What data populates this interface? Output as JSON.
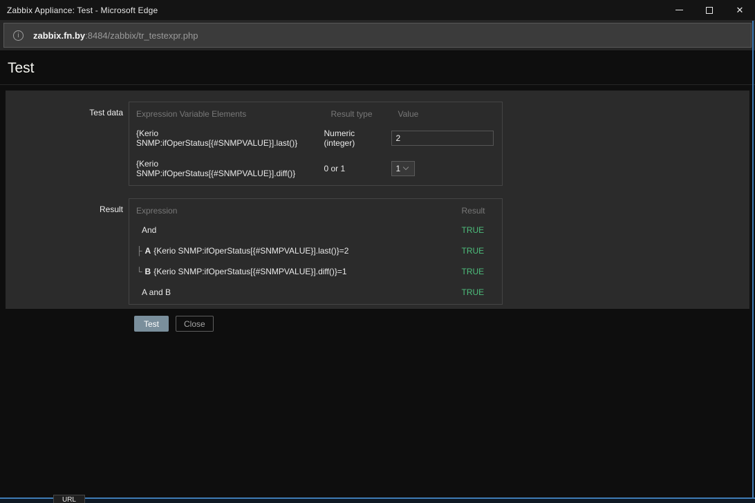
{
  "window": {
    "title": "Zabbix Appliance: Test - Microsoft Edge",
    "close_glyph": "✕"
  },
  "address_bar": {
    "info_glyph": "i",
    "host": "zabbix.fn.by",
    "path": ":8484/zabbix/tr_testexpr.php"
  },
  "page": {
    "heading": "Test",
    "test_data": {
      "label": "Test data",
      "headers": [
        "Expression Variable Elements",
        "Result type",
        "Value"
      ],
      "rows": [
        {
          "expression": "{Kerio SNMP:ifOperStatus[{#SNMPVALUE}].last()}",
          "result_type": "Numeric (integer)",
          "value": "2",
          "control": "text-input"
        },
        {
          "expression": "{Kerio SNMP:ifOperStatus[{#SNMPVALUE}].diff()}",
          "result_type": "0 or 1",
          "value": "1",
          "control": "select"
        }
      ]
    },
    "result": {
      "label": "Result",
      "headers": [
        "Expression",
        "Result"
      ],
      "rows": [
        {
          "prefix": "",
          "letter": "",
          "expression": "And",
          "result": "TRUE"
        },
        {
          "prefix": "├",
          "letter": "A",
          "expression": "{Kerio SNMP:ifOperStatus[{#SNMPVALUE}].last()}=2",
          "result": "TRUE"
        },
        {
          "prefix": "└",
          "letter": "B",
          "expression": "{Kerio SNMP:ifOperStatus[{#SNMPVALUE}].diff()}=1",
          "result": "TRUE"
        },
        {
          "prefix": "",
          "letter": "",
          "expression": "A and B",
          "result": "TRUE"
        }
      ]
    },
    "buttons": {
      "test": "Test",
      "close": "Close"
    }
  },
  "footer": {
    "status_fragment": "URL"
  },
  "colors": {
    "true_green": "#4dbd7b",
    "primary_button": "#7a8f9c",
    "window_accent_border": "#3f7cb6",
    "panel_background": "#2b2b2b",
    "page_background": "#0e0e0e"
  }
}
